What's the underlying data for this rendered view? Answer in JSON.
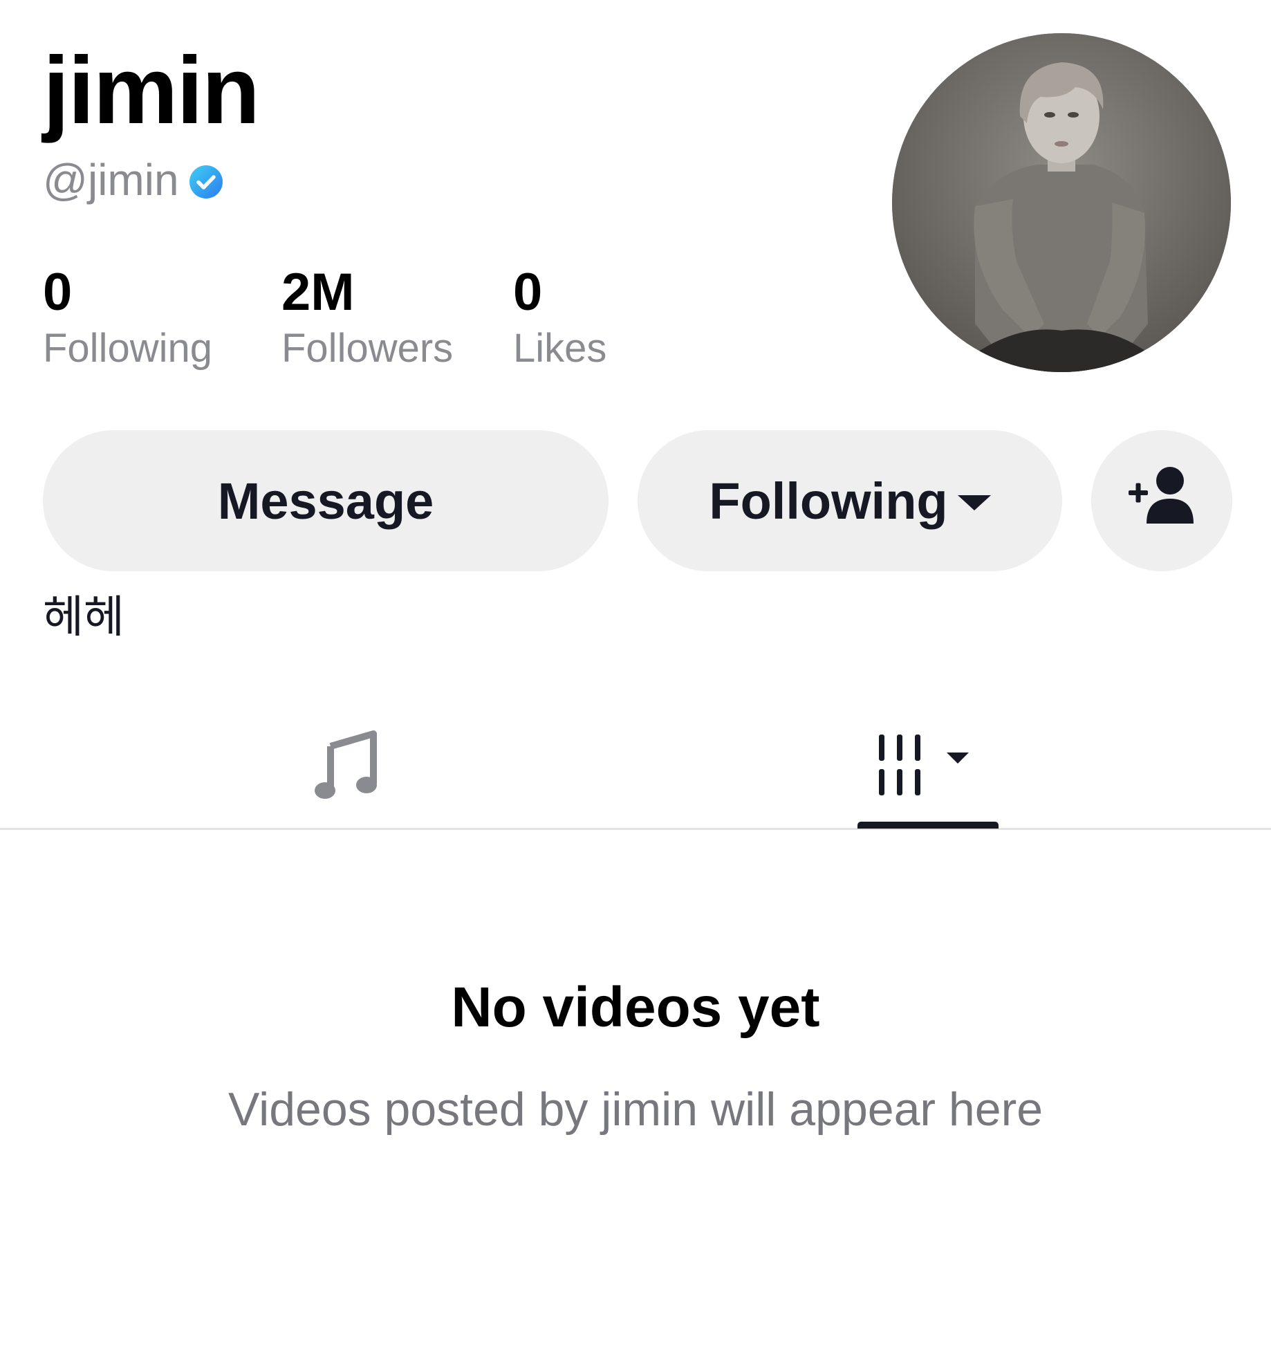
{
  "profile": {
    "display_name": "jimin",
    "handle": "@jimin",
    "verified": true,
    "bio": "헤헤"
  },
  "stats": [
    {
      "value": "0",
      "label": "Following"
    },
    {
      "value": "2M",
      "label": "Followers"
    },
    {
      "value": "0",
      "label": "Likes"
    }
  ],
  "actions": {
    "message_label": "Message",
    "following_label": "Following",
    "add_friend_icon": "add-user-icon"
  },
  "tabs": [
    {
      "icon": "music-note-icon",
      "selected": false
    },
    {
      "icon": "grid-dropdown-icon",
      "selected": true
    }
  ],
  "empty_state": {
    "title": "No videos yet",
    "subtitle": "Videos posted by jimin will appear here"
  },
  "colors": {
    "text_primary": "#161823",
    "text_secondary": "#8a8b91",
    "button_bg": "#efefef",
    "verified_blue": "#20d5ec",
    "divider": "#e3e3e4"
  }
}
